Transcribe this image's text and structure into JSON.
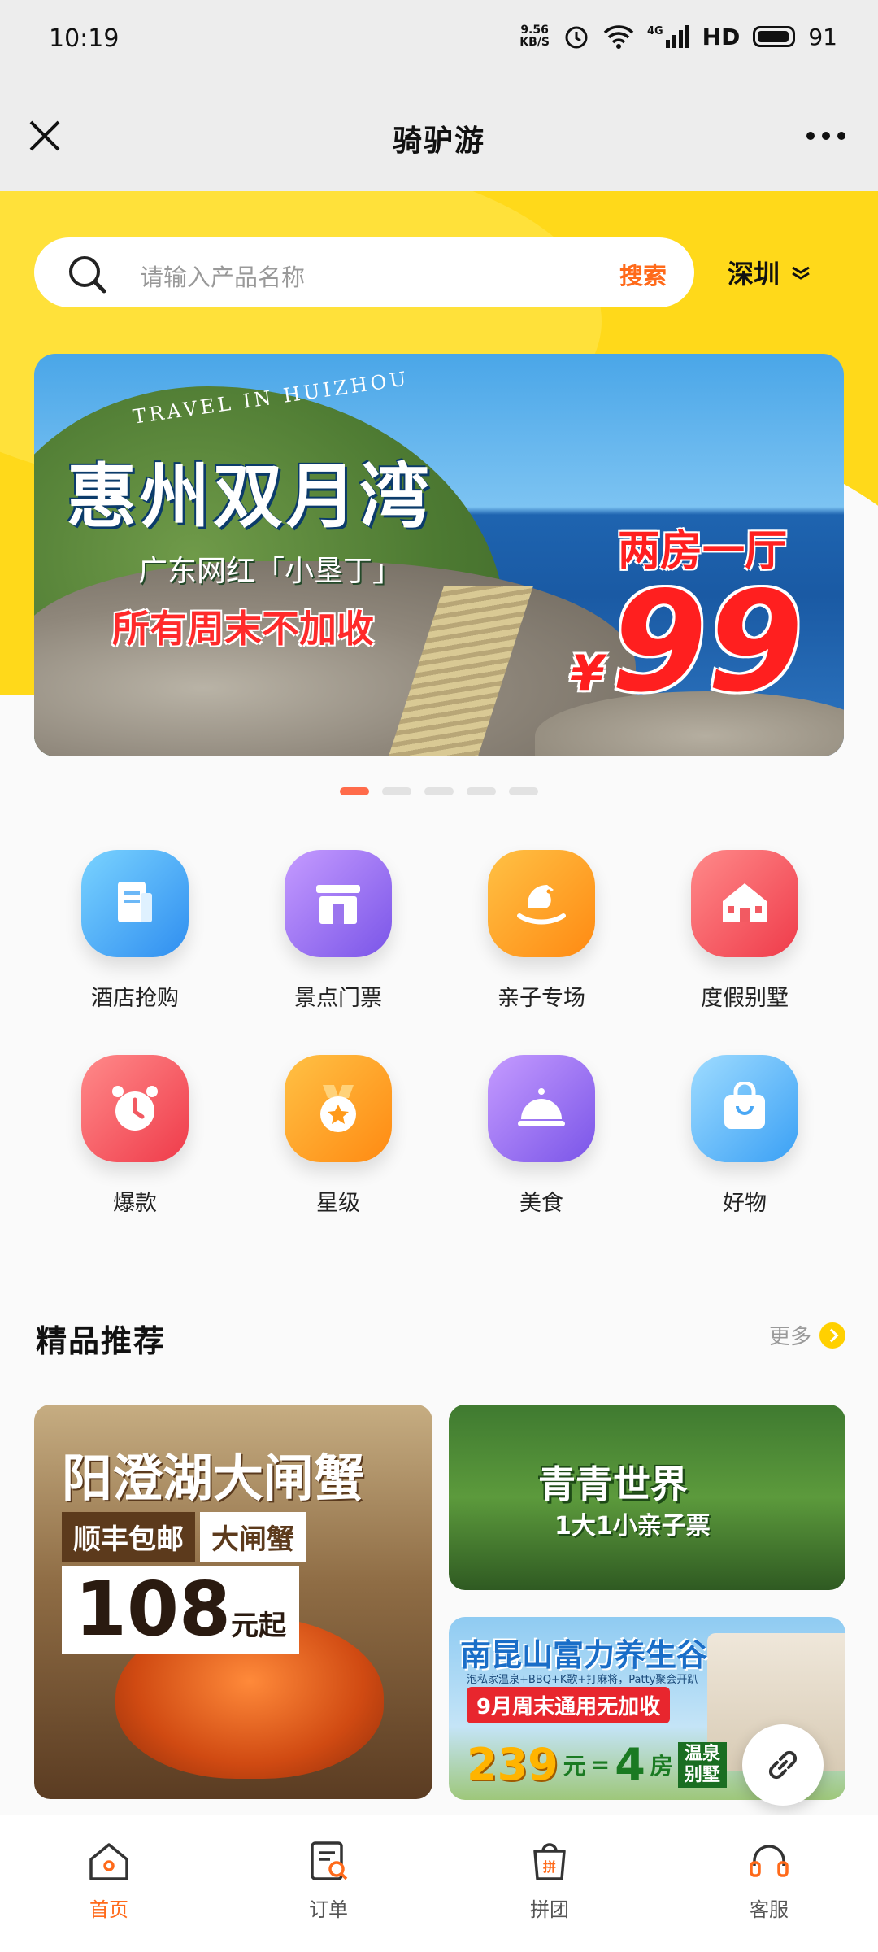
{
  "status_bar": {
    "time": "10:19",
    "speed_value": "9.56",
    "speed_unit": "KB/S",
    "network": "4G",
    "hd": "HD",
    "battery": "91"
  },
  "navbar": {
    "title": "骑驴游"
  },
  "search": {
    "placeholder": "请输入产品名称",
    "button": "搜索",
    "city": "深圳"
  },
  "banner": {
    "tag_en": "TRAVEL IN HUIZHOU",
    "headline": "惠州双月湾",
    "subline": "广东网红「小垦丁」",
    "promo": "所有周末不加收",
    "rooms": "两房一厅",
    "currency": "¥",
    "price": "99",
    "active_index": 0,
    "total": 5
  },
  "categories": [
    {
      "label": "酒店抢购",
      "icon": "hotel-icon",
      "color": "blue"
    },
    {
      "label": "景点门票",
      "icon": "scenic-gate-icon",
      "color": "purple"
    },
    {
      "label": "亲子专场",
      "icon": "rocking-horse-icon",
      "color": "orange"
    },
    {
      "label": "度假别墅",
      "icon": "villa-icon",
      "color": "red"
    },
    {
      "label": "爆款",
      "icon": "alarm-clock-icon",
      "color": "red"
    },
    {
      "label": "星级",
      "icon": "star-medal-icon",
      "color": "orange"
    },
    {
      "label": "美食",
      "icon": "food-cloche-icon",
      "color": "purple"
    },
    {
      "label": "好物",
      "icon": "shopping-bag-icon",
      "color": "blue"
    }
  ],
  "section": {
    "title": "精品推荐",
    "more": "更多"
  },
  "products": {
    "crab": {
      "title": "阳澄湖大闸蟹",
      "tag1": "顺丰包邮",
      "tag2": "大闸蟹",
      "price": "108",
      "unit": "元起"
    },
    "world": {
      "title": "青青世界",
      "subtitle": "1大1小亲子票"
    },
    "spa": {
      "title": "南昆山富力养生谷",
      "small": "泡私家温泉+BBQ+K歌+打麻将，Patty聚会开趴",
      "promo": "9月周末通用无加收",
      "price": "239",
      "price_unit": "元",
      "eq": "=",
      "rooms": "4",
      "rooms_unit": "房",
      "tag_line1": "温泉",
      "tag_line2": "别墅"
    }
  },
  "tabbar": [
    {
      "label": "首页",
      "icon": "home-icon",
      "active": true
    },
    {
      "label": "订单",
      "icon": "order-icon",
      "active": false
    },
    {
      "label": "拼团",
      "icon": "group-buy-icon",
      "active": false
    },
    {
      "label": "客服",
      "icon": "headset-icon",
      "active": false
    }
  ],
  "colors": {
    "brand_yellow": "#ffd91a",
    "accent_orange": "#ff6a1a",
    "promo_red": "#ff1f1f"
  }
}
